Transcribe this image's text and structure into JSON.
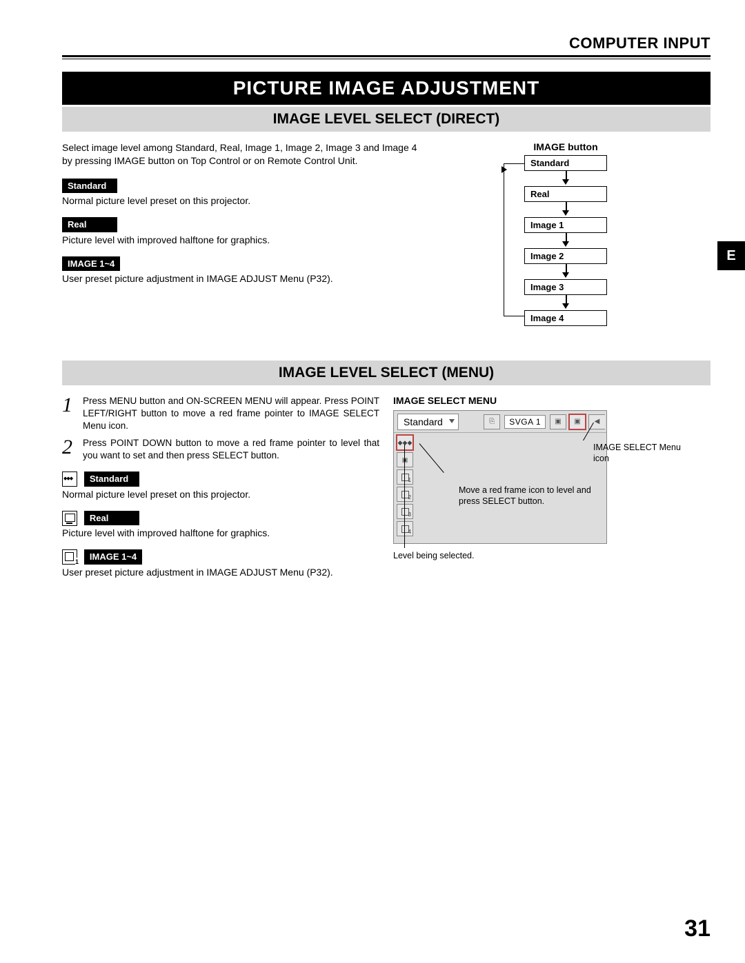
{
  "header": "COMPUTER INPUT",
  "section_title": "PICTURE IMAGE ADJUSTMENT",
  "side_tab": "E",
  "page_number": "31",
  "direct": {
    "title": "IMAGE LEVEL SELECT (DIRECT)",
    "intro": "Select image level among Standard, Real, Image 1, Image 2, Image 3 and Image 4 by pressing IMAGE button on Top Control or on Remote Control Unit.",
    "items": [
      {
        "label": "Standard",
        "desc": "Normal picture level preset on this projector."
      },
      {
        "label": "Real",
        "desc": "Picture level with improved halftone for graphics."
      },
      {
        "label": "IMAGE 1~4",
        "desc": "User preset picture adjustment in IMAGE ADJUST Menu (P32)."
      }
    ],
    "flow_title": "IMAGE button",
    "flow_items": [
      "Standard",
      "Real",
      "Image 1",
      "Image 2",
      "Image 3",
      "Image 4"
    ]
  },
  "menu": {
    "title": "IMAGE LEVEL SELECT (MENU)",
    "steps": [
      {
        "num": "1",
        "text": "Press MENU button and ON-SCREEN MENU will appear.  Press POINT LEFT/RIGHT button to move a red frame pointer to IMAGE SELECT Menu icon."
      },
      {
        "num": "2",
        "text": "Press POINT DOWN button to move a red frame pointer to level that you want to set and then press SELECT button."
      }
    ],
    "items": [
      {
        "label": "Standard",
        "desc": "Normal picture level preset on this projector."
      },
      {
        "label": "Real",
        "desc": "Picture level with improved halftone for graphics."
      },
      {
        "label": "IMAGE 1~4",
        "desc": "User preset picture adjustment in IMAGE ADJUST Menu (P32)."
      }
    ],
    "shot_title": "IMAGE SELECT MENU",
    "shot_mode": "Standard",
    "shot_signal": "SVGA 1",
    "callout_icon": "IMAGE SELECT Menu icon",
    "callout_move": "Move a red frame icon to level and press SELECT button.",
    "callout_level": "Level being selected."
  }
}
